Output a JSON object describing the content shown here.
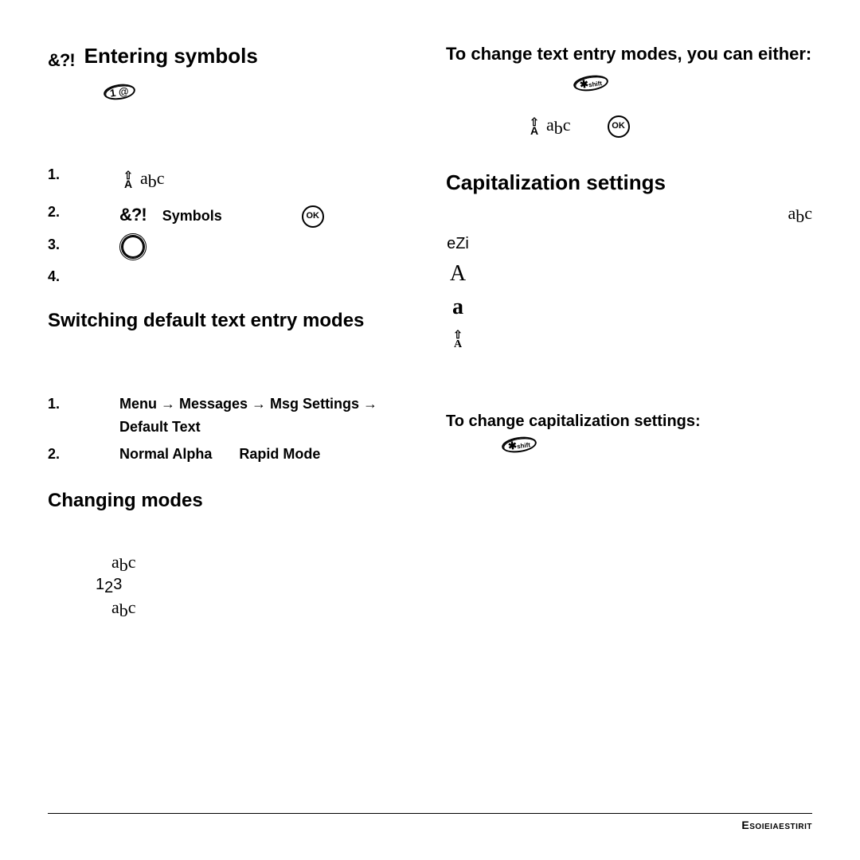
{
  "left": {
    "h_entering_symbols": "Entering symbols",
    "symbols_glyph": "&?!",
    "key_1_label": "1   @",
    "steps1": {
      "s2_label": "Symbols"
    },
    "h_switching": "Switching default text entry modes",
    "steps2": {
      "s1_path": "Menu → Messages → Msg Settings → Default Text",
      "s2_a": "Normal Alpha",
      "s2_b": "Rapid Mode"
    },
    "h_changing": "Changing modes",
    "abc_glyph": "abc",
    "n123_glyph": "123"
  },
  "right": {
    "lead": "To change text entry modes, you can either:",
    "shift_label": "shift",
    "ok_label": "OK",
    "h_cap": "Capitalization settings",
    "ezi": "eZi",
    "cap_A": "A",
    "cap_a": "a",
    "h_change_cap": "To change capitalization settings:"
  },
  "footer": "Esoieiaestirit"
}
